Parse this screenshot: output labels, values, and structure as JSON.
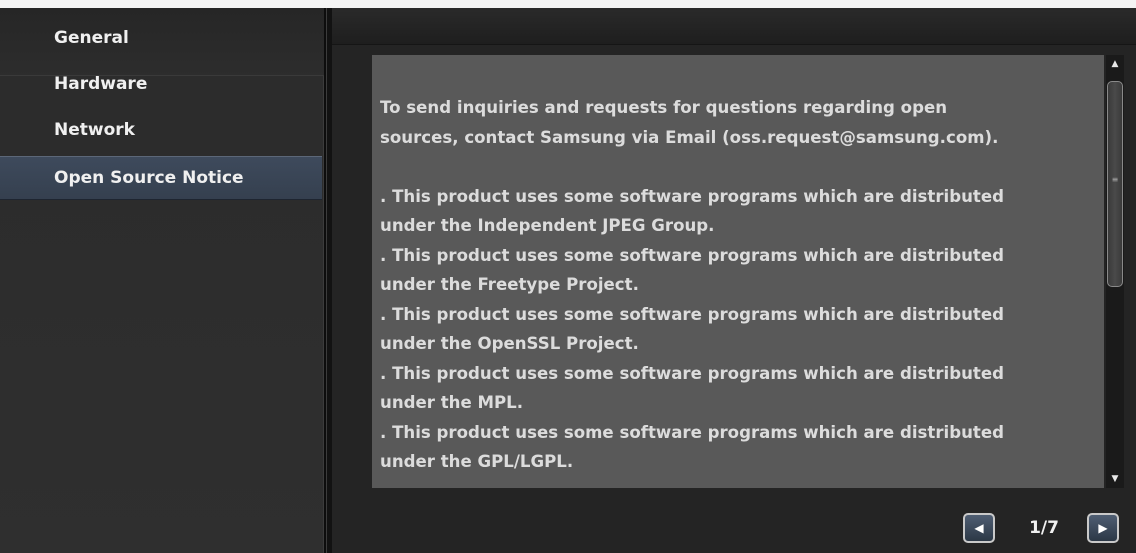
{
  "sidebar": {
    "items": [
      {
        "label": "General"
      },
      {
        "label": "Hardware"
      },
      {
        "label": "Network"
      },
      {
        "label": "Open Source Notice"
      }
    ],
    "selected": "Open Source Notice"
  },
  "notice": {
    "text": "To send inquiries and requests for questions regarding open\nsources, contact Samsung via Email (oss.request@samsung.com).\n\n. This product uses some software programs which are distributed\nunder the Independent JPEG Group.\n. This product uses some software programs which are distributed\nunder the Freetype Project.\n. This product uses some software programs which are distributed\nunder the OpenSSL Project.\n. This product uses some software programs which are distributed\nunder the MPL.\n. This product uses some software programs which are distributed\nunder the GPL/LGPL."
  },
  "scrollbar": {
    "up_icon": "up-arrow-icon",
    "down_icon": "down-arrow-icon",
    "up_glyph": "▲",
    "down_glyph": "▼",
    "grip_glyph": "≡"
  },
  "pager": {
    "prev_glyph": "◀",
    "next_glyph": "▶",
    "page": "1/7"
  },
  "colors": {
    "selected_item": "#3a4657",
    "panel": "#595959",
    "text": "#dcdcdc"
  }
}
